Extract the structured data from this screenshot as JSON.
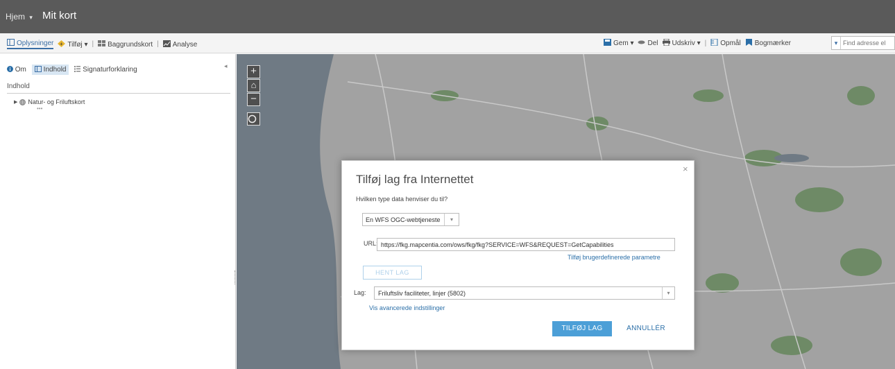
{
  "header": {
    "home_label": "Hjem",
    "home_caret": "▾",
    "map_title": "Mit kort"
  },
  "toolbar": {
    "details": "Oplysninger",
    "add": "Tilføj",
    "add_caret": "▾",
    "basemap": "Baggrundskort",
    "analysis": "Analyse",
    "save": "Gem",
    "share": "Del",
    "print": "Udskriv",
    "measure": "Opmål",
    "bookmarks": "Bogmærker",
    "search_placeholder": "Find adresse el",
    "caret": "▾"
  },
  "sidepanel": {
    "tab_about": "Om",
    "tab_content": "Indhold",
    "tab_legend": "Signaturforklaring",
    "heading": "Indhold",
    "layer_name": "Natur- og Friluftskort",
    "layer_dots": "•••"
  },
  "map_controls": {
    "zoom_in": "+",
    "home": "⌂",
    "zoom_out": "−"
  },
  "dialog": {
    "title": "Tilføj lag fra Internettet",
    "question": "Hvilken type data henviser du til?",
    "type_value": "En WFS OGC-webtjeneste",
    "url_label": "URL:",
    "url_value": "https://fkg.mapcentia.com/ows/fkg/fkg?SERVICE=WFS&REQUEST=GetCapabilities",
    "custom_params": "Tilføj brugerdefinerede parametre",
    "fetch_button": "HENT LAG",
    "layer_label": "Lag:",
    "layer_value": "Friluftsliv faciliteter, linjer (5802)",
    "advanced": "Vis avancerede indstillinger",
    "add_button": "TILFØJ LAG",
    "cancel_button": "ANNULLÉR",
    "close": "×"
  },
  "colors": {
    "accent": "#4c9fd7",
    "link": "#2b6fa8",
    "header_bg": "#5a5a5a",
    "map_bg": "#9a9a9a"
  }
}
